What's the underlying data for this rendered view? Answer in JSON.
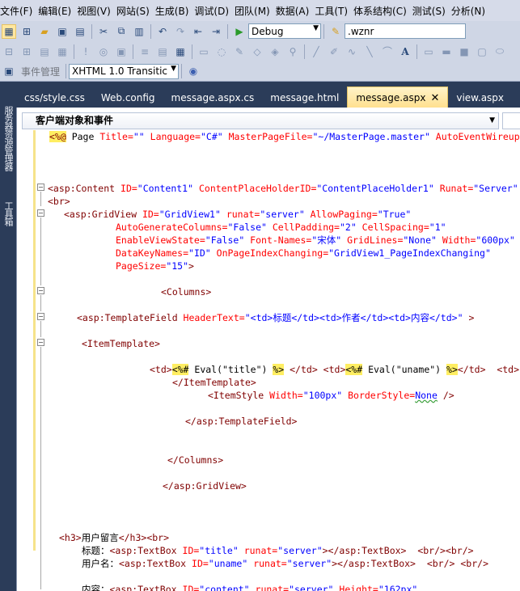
{
  "menu": [
    "文件(F)",
    "编辑(E)",
    "视图(V)",
    "网站(S)",
    "生成(B)",
    "调试(D)",
    "团队(M)",
    "数据(A)",
    "工具(T)",
    "体系结构(C)",
    "测试(S)",
    "分析(N)"
  ],
  "toolbar1": {
    "config_combo": "Debug",
    "find_combo": ".wznr"
  },
  "toolbar3": {
    "faded_label": "事件管理",
    "doctype_combo": "XHTML 1.0 Transitic"
  },
  "side_tabs": [
    "服务器资源管理器",
    "工具箱"
  ],
  "doc_tabs": [
    {
      "label": "css/style.css",
      "active": false
    },
    {
      "label": "Web.config",
      "active": false
    },
    {
      "label": "message.aspx.cs",
      "active": false
    },
    {
      "label": "message.html",
      "active": false
    },
    {
      "label": "message.aspx",
      "active": true
    },
    {
      "label": "view.aspx",
      "active": false
    }
  ],
  "navbar": {
    "left": "客户端对象和事件",
    "right": "("
  },
  "code": {
    "l1": [
      "<%@",
      " Page ",
      "Title=",
      "\"\"",
      " Language=",
      "\"C#\"",
      " MasterPageFile=",
      "\"~/MasterPage.master\"",
      " AutoEventWireup"
    ],
    "l2": [
      "<asp:Content",
      " ID=",
      "\"Content1\"",
      " ContentPlaceHolderID=",
      "\"ContentPlaceHolder1\"",
      " Runat=",
      "\"Server\""
    ],
    "l3": "<br>",
    "l4": [
      "<asp:GridView",
      " ID=",
      "\"GridView1\"",
      " runat=",
      "\"server\"",
      " AllowPaging=",
      "\"True\""
    ],
    "l5": [
      "AutoGenerateColumns=",
      "\"False\"",
      " CellPadding=",
      "\"2\"",
      " CellSpacing=",
      "\"1\""
    ],
    "l6": [
      "EnableViewState=",
      "\"False\"",
      " Font-Names=",
      "\"宋体\"",
      " GridLines=",
      "\"None\"",
      " Width=",
      "\"600px\""
    ],
    "l7": [
      "DataKeyNames=",
      "\"ID\"",
      " OnPageIndexChanging=",
      "\"GridView1_PageIndexChanging\""
    ],
    "l8": [
      "PageSize=",
      "\"15\"",
      ">"
    ],
    "l9": "<Columns>",
    "l10": [
      "<asp:TemplateField",
      " HeaderText=",
      "\"<td>标题</td><td>作者</td><td>内容</td>\"",
      " >"
    ],
    "l11": "<ItemTemplate>",
    "l12": [
      "<td>",
      "<%#",
      " Eval(\"title\") ",
      "%>",
      " </td> <td>",
      "<%#",
      " Eval(\"uname\") ",
      "%>",
      "</td>  <td>"
    ],
    "l13": "</ItemTemplate>",
    "l14": [
      "<ItemStyle",
      " Width=",
      "\"100px\"",
      " BorderStyle=",
      "None",
      " />"
    ],
    "l15": "</asp:TemplateField>",
    "l16": "</Columns>",
    "l17": "</asp:GridView>",
    "l18": [
      "<h3>",
      "用户留言",
      "</h3>",
      "<br>"
    ],
    "l19": [
      "标题：",
      "<asp:TextBox",
      " ID=",
      "\"title\"",
      " runat=",
      "\"server\"",
      "></asp:TextBox>",
      "  <br/>",
      "<br/>"
    ],
    "l20": [
      "用户名：",
      "<asp:TextBox",
      " ID=",
      "\"uname\"",
      " runat=",
      "\"server\"",
      "></asp:TextBox>",
      "  <br/>",
      " <br/>"
    ],
    "l21": [
      "内容：",
      "<asp:TextBox",
      " ID=",
      "\"content\"",
      " runat=",
      "\"server\"",
      " Height=",
      "\"162px\""
    ]
  },
  "colors": {
    "tag": "#800000",
    "attr": "#ff0000",
    "value": "#0000ff",
    "highlight": "#ffee62",
    "chrome": "#2b3c59",
    "active_tab": "#ffe08f"
  }
}
